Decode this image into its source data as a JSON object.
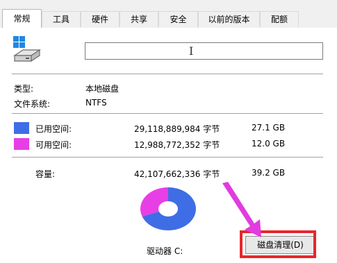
{
  "tabs": [
    {
      "label": "常规",
      "active": true
    },
    {
      "label": "工具",
      "active": false
    },
    {
      "label": "硬件",
      "active": false
    },
    {
      "label": "共享",
      "active": false
    },
    {
      "label": "安全",
      "active": false
    },
    {
      "label": "以前的版本",
      "active": false
    },
    {
      "label": "配额",
      "active": false
    }
  ],
  "general": {
    "name_value": "",
    "type_label": "类型:",
    "type_value": "本地磁盘",
    "fs_label": "文件系统:",
    "fs_value": "NTFS"
  },
  "space": {
    "used": {
      "label": "已用空间:",
      "bytes": "29,118,889,984 字节",
      "size": "27.1 GB",
      "color": "#3f6de6"
    },
    "free": {
      "label": "可用空间:",
      "bytes": "12,988,772,352 字节",
      "size": "12.0 GB",
      "color": "#e83ee6"
    },
    "capacity": {
      "label": "容量:",
      "bytes": "42,107,662,336 字节",
      "size": "39.2 GB"
    },
    "used_fraction": 0.692
  },
  "drive_label": "驱动器 C:",
  "cleanup_button": "磁盘清理(D)",
  "annotation": {
    "color": "#e8262a",
    "arrow_color": "#e23be0"
  }
}
